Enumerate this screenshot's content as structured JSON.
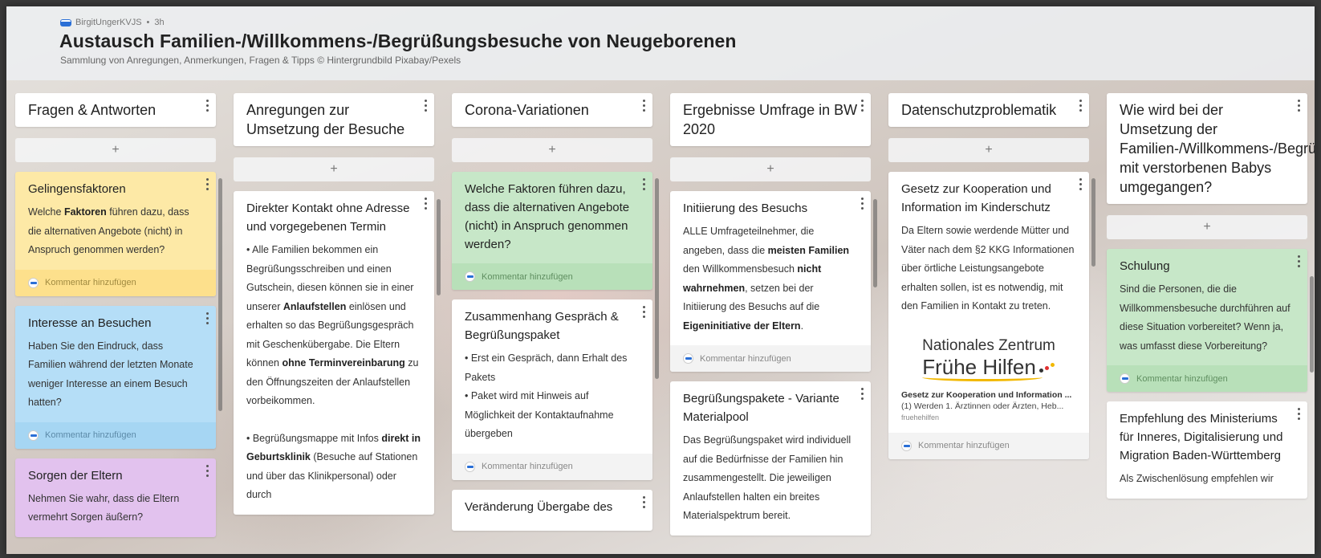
{
  "header": {
    "author": "BirgitUngerKVJS",
    "time": "3h",
    "title": "Austausch Familien-/Willkommens-/Begrüßungsbesuche von Neugeborenen",
    "subtitle": "Sammlung von Anregungen, Anmerkungen, Fragen & Tipps © Hintergrundbild Pixabay/Pexels"
  },
  "add_label": "+",
  "comment_label": "Kommentar hinzufügen",
  "columns": [
    {
      "title": "Fragen & Antworten",
      "cards": [
        {
          "title": "Gelingensfaktoren",
          "color": "#fde9a6"
        },
        {
          "title": "Interesse an Besuchen",
          "text": "Haben Sie den Eindruck, dass Familien während der letzten Monate weniger Interesse an einem Besuch hatten?",
          "color": "#b5def7"
        },
        {
          "title": "Sorgen der Eltern",
          "text": "Nehmen Sie wahr, dass die Eltern vermehrt Sorgen äußern?",
          "color": "#e2c2ee"
        }
      ]
    },
    {
      "title": "Anregungen zur Umsetzung der Besuche",
      "cards": [
        {
          "title": "Direkter Kontakt ohne Adresse und vorgegebenen Termin"
        }
      ]
    },
    {
      "title": "Corona-Variationen",
      "cards": [
        {
          "title": "Welche Faktoren führen dazu, dass die alternativen Angebote (nicht) in Anspruch genommen werden?",
          "color": "#c7e7c8"
        },
        {
          "title": "Zusammenhang Gespräch & Begrüßungspaket",
          "line1": "• Erst ein Gespräch, dann Erhalt des Pakets",
          "line2": "• Paket wird mit Hinweis auf Möglichkeit der Kontaktaufnahme übergeben"
        },
        {
          "title": "Veränderung Übergabe des"
        }
      ]
    },
    {
      "title": "Ergebnisse Umfrage in BW 2020",
      "cards": [
        {
          "title": "Initiierung des Besuchs"
        },
        {
          "title": "Begrüßungspakete - Variante Materialpool",
          "text": "Das Begrüßungspaket wird individuell auf die Bedürfnisse der Familien hin zusammengestellt. Die jeweiligen Anlaufstellen halten ein breites Materialspektrum bereit."
        }
      ]
    },
    {
      "title": "Datenschutzproblematik",
      "cards": [
        {
          "title": "Gesetz zur Kooperation und Information im Kinderschutz",
          "text": "Da Eltern sowie werdende Mütter und Väter nach dem §2 KKG Informationen über örtliche Leistungsangebote erhalten sollen, ist es notwendig, mit den Familien in Kontakt zu treten.",
          "logo_line1": "Nationales Zentrum",
          "logo_line2": "Frühe Hilfen",
          "attach_title": "Gesetz zur Kooperation und Information ...",
          "attach_text": "(1) Werden 1. Ärztinnen oder Ärzten, Heb...",
          "attach_source": "fruehehilfen"
        }
      ]
    },
    {
      "title": "Wie wird bei der Umsetzung der Familien-/Willkommens-/Begrüßungsbesuche mit verstorbenen Babys umgegangen?",
      "cards": [
        {
          "title": "Schulung",
          "text": "Sind die Personen, die die Willkommensbesuche durchführen auf diese Situation vorbereitet? Wenn ja, was umfasst diese Vorbereitung?",
          "color": "#c7e7c8"
        },
        {
          "title": "Empfehlung des Ministeriums für Inneres, Digitalisierung und Migration Baden-Württemberg",
          "text": "Als Zwischenlösung empfehlen wir"
        }
      ]
    }
  ],
  "rich": {
    "gelingen": [
      "Welche ",
      "Faktoren",
      " führen dazu, dass die alternativen Angebote (nicht) in Anspruch genommen werden?"
    ],
    "direkt_1": [
      "• Alle Familien bekommen ein Begrüßungsschreiben und einen Gutschein, diesen können sie in einer unserer ",
      "Anlaufstellen",
      " einlösen und erhalten so das Begrüßungsgespräch mit Geschenkübergabe. Die Eltern können ",
      "ohne Terminvereinbarung",
      " zu den Öffnungszeiten der Anlaufstellen vorbeikommen."
    ],
    "direkt_2": [
      "• Begrüßungsmappe mit Infos ",
      "direkt in Geburtsklinik",
      " (Besuche auf Stationen und über das Klinikpersonal) oder durch"
    ],
    "initiierung": [
      "ALLE Umfrageteilnehmer, die angeben, dass die ",
      "meisten Familien",
      " den Willkommensbesuch ",
      "nicht wahrnehmen",
      ", setzen bei der Initiierung des Besuchs auf die ",
      "Eigeninitiative der Eltern",
      "."
    ]
  }
}
